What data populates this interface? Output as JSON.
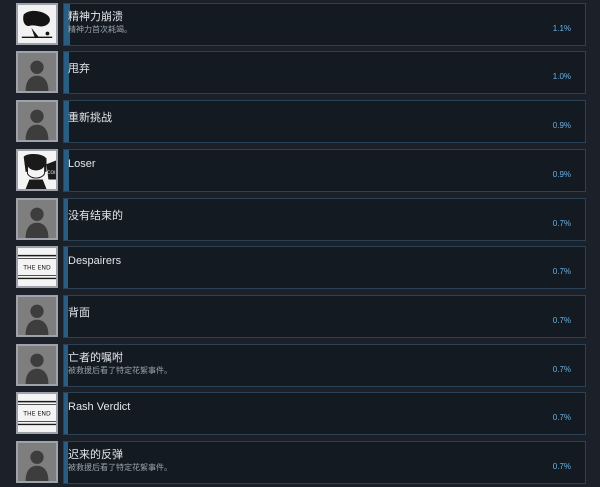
{
  "achievements": [
    {
      "icon": "ink-splash-icon",
      "title": "精神力崩溃",
      "desc": "精神力首次耗竭。",
      "percent": "1.1%",
      "progress": 0.011
    },
    {
      "icon": "silhouette-icon",
      "title": "甩弃",
      "desc": "",
      "percent": "1.0%",
      "progress": 0.01
    },
    {
      "icon": "silhouette-icon",
      "title": "重新挑战",
      "desc": "",
      "percent": "0.9%",
      "progress": 0.009
    },
    {
      "icon": "character-portrait-icon",
      "title": "Loser",
      "desc": "",
      "percent": "0.9%",
      "progress": 0.009
    },
    {
      "icon": "silhouette-icon",
      "title": "没有结束的",
      "desc": "",
      "percent": "0.7%",
      "progress": 0.007
    },
    {
      "icon": "the-end-icon",
      "title": "Despairers",
      "desc": "",
      "percent": "0.7%",
      "progress": 0.007,
      "icon_text": "THE END"
    },
    {
      "icon": "silhouette-icon",
      "title": "背面",
      "desc": "",
      "percent": "0.7%",
      "progress": 0.007
    },
    {
      "icon": "silhouette-icon",
      "title": "亡者的嘱咐",
      "desc": "被救援后看了特定花絮事件。",
      "percent": "0.7%",
      "progress": 0.007
    },
    {
      "icon": "the-end-icon",
      "title": "Rash Verdict",
      "desc": "",
      "percent": "0.7%",
      "progress": 0.007,
      "icon_text": "THE END"
    },
    {
      "icon": "silhouette-icon",
      "title": "迟来的反弹",
      "desc": "被救援后看了特定花絮事件。",
      "percent": "0.7%",
      "progress": 0.007
    }
  ]
}
